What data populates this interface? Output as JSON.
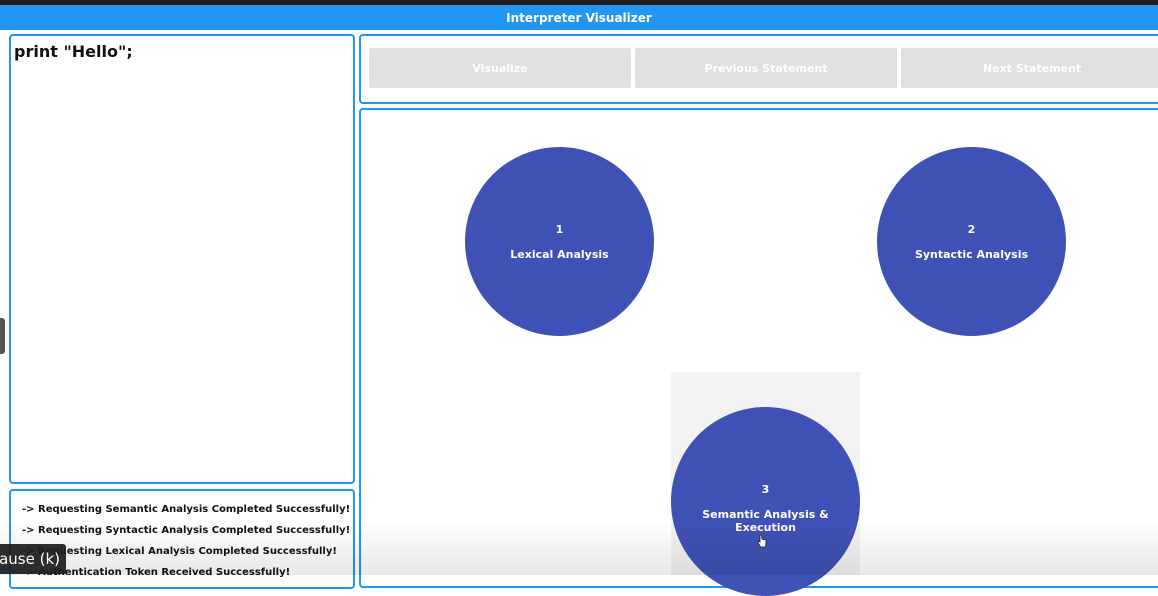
{
  "app": {
    "title": "Interpreter Visualizer"
  },
  "editor": {
    "code": "print \"Hello\";"
  },
  "log": {
    "lines": [
      "-> Requesting Semantic Analysis Completed Successfully!",
      "-> Requesting Syntactic Analysis Completed Successfully!",
      "-> Requesting Lexical Analysis Completed Successfully!",
      "-> Authentication Token Received Successfully!"
    ]
  },
  "controls": {
    "visualize": "Visualize",
    "previous": "Previous Statement",
    "next": "Next Statement"
  },
  "stages": [
    {
      "number": "1",
      "label": "Lexical Analysis"
    },
    {
      "number": "2",
      "label": "Syntactic Analysis"
    },
    {
      "number": "3",
      "label": "Semantic Analysis & Execution"
    }
  ],
  "player": {
    "tooltip": "Pause (k)"
  },
  "colors": {
    "accent": "#2196f3",
    "node": "#3f51b5",
    "button": "#e0e0e0"
  }
}
